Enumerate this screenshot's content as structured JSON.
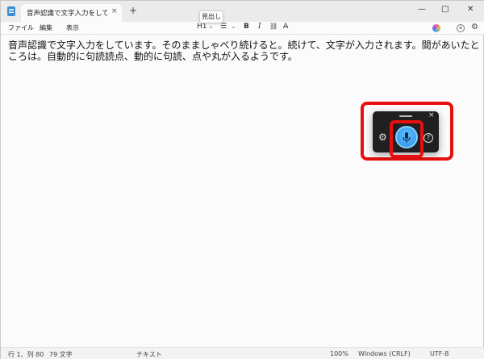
{
  "tab": {
    "title": "音声認識で文字入力をしています",
    "close": "×",
    "new": "+"
  },
  "window_controls": {
    "minimize": "—",
    "maximize": "□",
    "close": "✕"
  },
  "menu": {
    "file": "ファイル",
    "edit": "編集",
    "view": "表示"
  },
  "toolbar": {
    "heading": "H1",
    "heading_caret": "⌄",
    "list": "☰",
    "list_caret": "⌄",
    "bold": "B",
    "italic": "I",
    "link": "⛓",
    "clear_format": "A̶",
    "tooltip": "見出し",
    "profile_badge": "a",
    "settings_icon": "⚙"
  },
  "document": {
    "text": "音声認識で文字入力をしています。そのまましゃべり続けると。続けて、文字が入力されます。間があいたところは。自動的に句読読点、動的に句読、点や丸が入るようです。"
  },
  "voice_typing": {
    "close": "×",
    "settings_icon": "⚙",
    "help": "?"
  },
  "status": {
    "position": "行 1、列 80",
    "chars": "79 文字",
    "format": "テキスト",
    "zoom": "100%",
    "line_ending": "Windows (CRLF)",
    "encoding": "UTF-8"
  },
  "colors": {
    "mic_accent": "#2d8fe8",
    "highlight": "#e80f0f"
  }
}
